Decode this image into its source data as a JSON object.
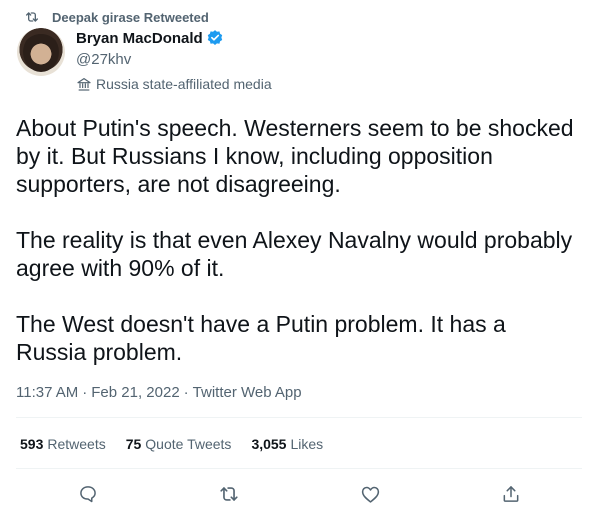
{
  "retweet_banner": {
    "text": "Deepak girase Retweeted",
    "icon": "retweet-icon"
  },
  "author": {
    "name": "Bryan MacDonald",
    "handle": "@27khv",
    "verified": true,
    "label": "Russia state-affiliated media",
    "label_icon": "flag-icon"
  },
  "tweet": {
    "paragraphs": [
      "About Putin's speech. Westerners seem to be shocked by it. But Russians I know, including opposition supporters, are not disagreeing.",
      "The reality is that even Alexey Navalny would probably agree with 90% of it.",
      "The West doesn't have a Putin problem. It has a Russia problem."
    ],
    "time": "11:37 AM",
    "separator": "·",
    "date": "Feb 21, 2022",
    "source": "Twitter Web App"
  },
  "stats": {
    "retweets_count": "593",
    "retweets_label": "Retweets",
    "quotes_count": "75",
    "quotes_label": "Quote Tweets",
    "likes_count": "3,055",
    "likes_label": "Likes"
  },
  "actions": [
    "reply-icon",
    "retweet-icon",
    "like-icon",
    "share-icon"
  ],
  "colors": {
    "text": "#0f1419",
    "secondary": "#536471",
    "verified": "#1d9bf0",
    "divider": "#eff3f4"
  }
}
